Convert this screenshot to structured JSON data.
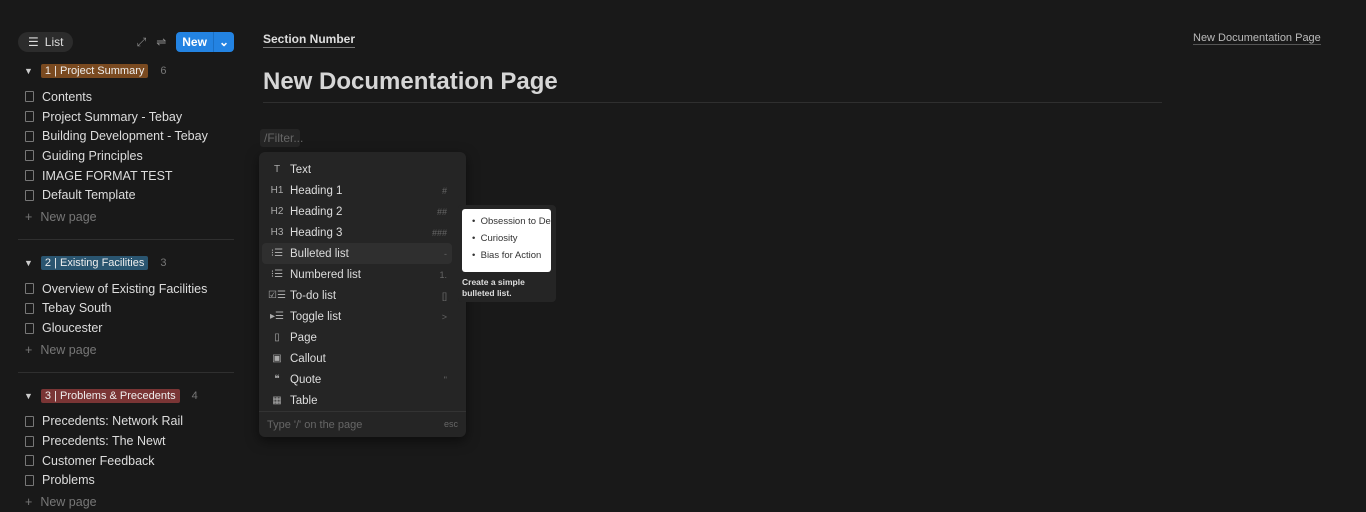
{
  "sidebar": {
    "view_label": "List",
    "new_label": "New",
    "groups": [
      {
        "tag": "1 | Project Summary",
        "color": "#7a4a20",
        "count": "6",
        "items": [
          "Contents",
          "Project Summary - Tebay",
          "Building Development - Tebay",
          "Guiding Principles",
          "IMAGE FORMAT TEST",
          "Default Template"
        ]
      },
      {
        "tag": "2 | Existing Facilities",
        "color": "#2a5570",
        "count": "3",
        "items": [
          "Overview of Existing Facilities",
          "Tebay South",
          "Gloucester"
        ]
      },
      {
        "tag": "3 | Problems & Precedents",
        "color": "#7a3535",
        "count": "4",
        "items": [
          "Precedents: Network Rail",
          "Precedents: The Newt",
          "Customer Feedback",
          "Problems"
        ]
      }
    ],
    "new_page": "New page"
  },
  "main": {
    "section": "Section Number",
    "title": "New Documentation Page",
    "top_right": "New Documentation Page",
    "filter_placeholder": "/Filter..."
  },
  "menu": {
    "items": [
      {
        "label": "Text",
        "icon": "T",
        "shortcut": ""
      },
      {
        "label": "Heading 1",
        "icon": "H1",
        "shortcut": "#"
      },
      {
        "label": "Heading 2",
        "icon": "H2",
        "shortcut": "##"
      },
      {
        "label": "Heading 3",
        "icon": "H3",
        "shortcut": "###"
      },
      {
        "label": "Bulleted list",
        "icon": "⁝☰",
        "shortcut": "-"
      },
      {
        "label": "Numbered list",
        "icon": "⁝☰",
        "shortcut": "1."
      },
      {
        "label": "To-do list",
        "icon": "☑☰",
        "shortcut": "[]"
      },
      {
        "label": "Toggle list",
        "icon": "▸☰",
        "shortcut": ">"
      },
      {
        "label": "Page",
        "icon": "▯",
        "shortcut": ""
      },
      {
        "label": "Callout",
        "icon": "▣",
        "shortcut": ""
      },
      {
        "label": "Quote",
        "icon": "❝",
        "shortcut": "\""
      },
      {
        "label": "Table",
        "icon": "▦",
        "shortcut": ""
      }
    ],
    "footer_a": "Type '/' on the page",
    "footer_esc": "esc"
  },
  "preview": {
    "bullets": [
      "Obsession to Detail",
      "Curiosity",
      "Bias for Action"
    ],
    "description": "Create a simple bulleted list."
  }
}
